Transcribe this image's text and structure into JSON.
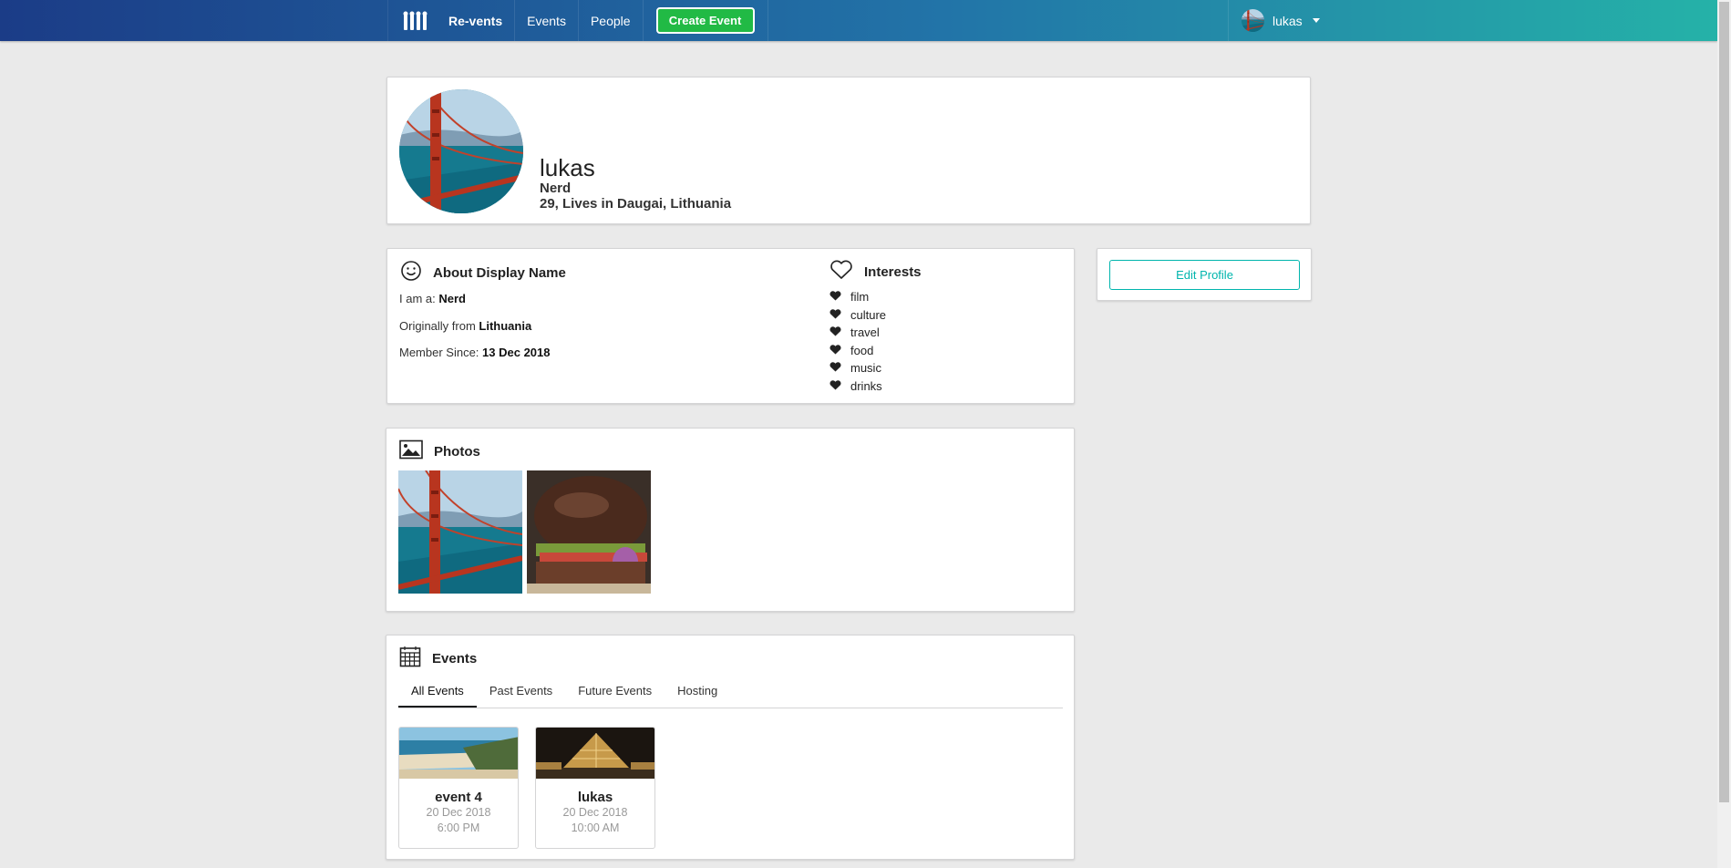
{
  "nav": {
    "brand": "Re-vents",
    "events": "Events",
    "people": "People",
    "create_event": "Create Event",
    "user_name": "lukas"
  },
  "profile": {
    "name": "lukas",
    "occupation": "Nerd",
    "location": "29, Lives in Daugai, Lithuania"
  },
  "about": {
    "title": "About Display Name",
    "i_am_label": "I am a: ",
    "i_am_value": "Nerd",
    "from_label": "Originally from ",
    "from_value": "Lithuania",
    "member_label": "Member Since: ",
    "member_value": "13 Dec 2018"
  },
  "interests": {
    "title": "Interests",
    "items": [
      "film",
      "culture",
      "travel",
      "food",
      "music",
      "drinks"
    ]
  },
  "edit_profile": "Edit Profile",
  "photos": {
    "title": "Photos"
  },
  "events": {
    "title": "Events",
    "tabs": [
      "All Events",
      "Past Events",
      "Future Events",
      "Hosting"
    ],
    "active_tab": "All Events",
    "items": [
      {
        "title": "event 4",
        "date": "20 Dec 2018",
        "time": "6:00 PM"
      },
      {
        "title": "lukas",
        "date": "20 Dec 2018",
        "time": "10:00 AM"
      }
    ]
  }
}
